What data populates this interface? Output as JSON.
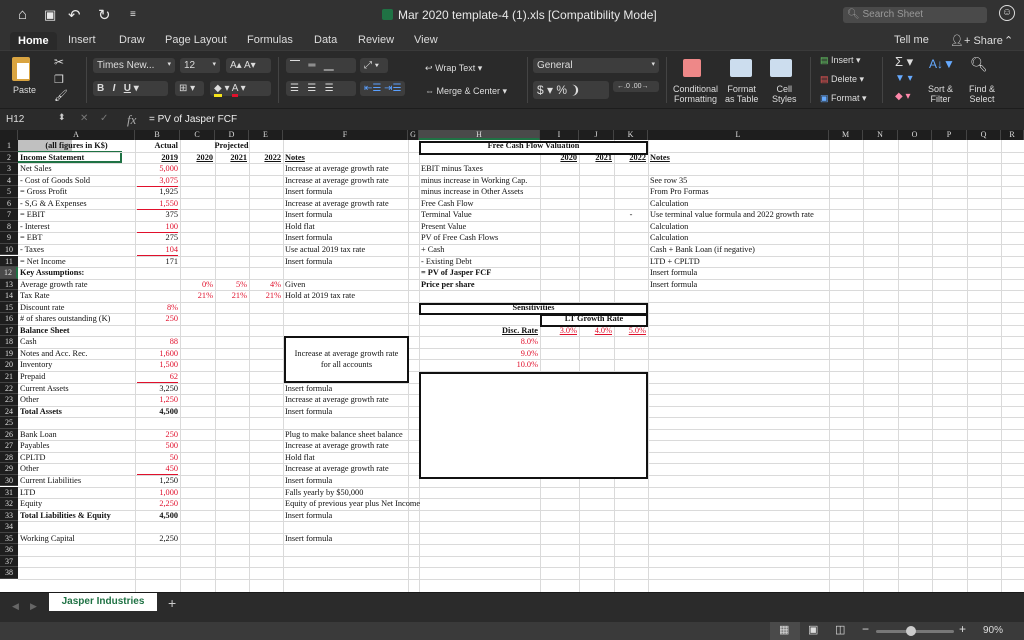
{
  "window": {
    "title": "Mar 2020 template-4 (1).xls  [Compatibility Mode]",
    "search_placeholder": "Search Sheet",
    "quick_access": [
      "home-icon",
      "save-icon",
      "undo-icon",
      "redo-icon",
      "customize-icon"
    ]
  },
  "ribbon_tabs": [
    "Home",
    "Insert",
    "Draw",
    "Page Layout",
    "Formulas",
    "Data",
    "Review",
    "View"
  ],
  "ribbon_right": {
    "tell_me": "Tell me",
    "share": "Share"
  },
  "ribbon": {
    "paste": "Paste",
    "font_name": "Times New...",
    "font_size": "12",
    "wrap_text": "Wrap Text",
    "merge_center": "Merge & Center",
    "number_format": "General",
    "conditional_formatting": [
      "Conditional",
      "Formatting"
    ],
    "format_as_table": [
      "Format",
      "as Table"
    ],
    "cell_styles": [
      "Cell",
      "Styles"
    ],
    "insert": "Insert",
    "delete": "Delete",
    "format": "Format",
    "sort_filter": [
      "Sort &",
      "Filter"
    ],
    "find_select": [
      "Find &",
      "Select"
    ],
    "colors": {
      "fill": "#f5e31a",
      "font": "#e0102c"
    }
  },
  "formula_bar": {
    "name_box": "H12",
    "fx": "fx",
    "formula": "= PV of Jasper FCF"
  },
  "columns": [
    "A",
    "B",
    "C",
    "D",
    "E",
    "F",
    "G",
    "H",
    "I",
    "J",
    "K",
    "L",
    "M",
    "N",
    "O",
    "P",
    "Q",
    "R"
  ],
  "rows": [
    "1",
    "2",
    "3",
    "4",
    "5",
    "6",
    "7",
    "8",
    "9",
    "10",
    "11",
    "12",
    "13",
    "14",
    "15",
    "16",
    "17",
    "18",
    "19",
    "20",
    "21",
    "22",
    "23",
    "24",
    "25",
    "26",
    "27",
    "28",
    "29",
    "30",
    "31",
    "32",
    "33",
    "34",
    "35",
    "36",
    "37",
    "38"
  ],
  "income": {
    "header_a": "(all figures in K$)",
    "actual": "Actual",
    "projected": "Projected",
    "years": [
      "2019",
      "2020",
      "2021",
      "2022"
    ],
    "notes_label": "Notes",
    "section": "Income Statement",
    "lines": [
      {
        "label": "Net Sales",
        "value": "5,000",
        "note": "Increase at average growth rate"
      },
      {
        "label": " - Cost of Goods Sold",
        "value": "3,075",
        "note": "Increase at average growth rate"
      },
      {
        "label": " = Gross Profit",
        "value": "1,925",
        "note": "Insert formula"
      },
      {
        "label": " - S,G & A Expenses",
        "value": "1,550",
        "note": "Increase at average growth rate"
      },
      {
        "label": " = EBIT",
        "value": "375",
        "note": "Insert formula"
      },
      {
        "label": " - Interest",
        "value": "100",
        "note": "Hold flat"
      },
      {
        "label": " = EBT",
        "value": "275",
        "note": "Insert formula"
      },
      {
        "label": " - Taxes",
        "value": "104",
        "note": "Use actual 2019 tax rate"
      },
      {
        "label": " = Net Income",
        "value": "171",
        "note": "Insert formula"
      }
    ]
  },
  "assumptions": {
    "title": "Key Assumptions:",
    "growth_label": "Average growth rate",
    "growth": [
      "0%",
      "5%",
      "4%"
    ],
    "growth_note": "Given",
    "tax_label": "Tax Rate",
    "tax": [
      "21%",
      "21%",
      "21%"
    ],
    "tax_note": "Hold at 2019 tax rate",
    "discount_label": "Discount rate",
    "discount": "8%",
    "shares_label": "# of shares outstanding (K)",
    "shares": "250"
  },
  "balance": {
    "title": "Balance Sheet",
    "assets": [
      {
        "label": "Cash",
        "value": "88"
      },
      {
        "label": "Notes and Acc. Rec.",
        "value": "1,600"
      },
      {
        "label": "Inventory",
        "value": "1,500"
      },
      {
        "label": "Prepaid",
        "value": "62"
      },
      {
        "label": "Current Assets",
        "value": "3,250",
        "note": "Insert formula"
      },
      {
        "label": "Other",
        "value": "1,250",
        "note": "Increase at average growth rate"
      },
      {
        "label": "Total Assets",
        "value": "4,500",
        "note": "Insert formula"
      }
    ],
    "asset_box_note": "Increase at average growth rate for all accounts",
    "liabilities": [
      {
        "label": "Bank Loan",
        "value": "250",
        "note": "Plug to make balance sheet balance"
      },
      {
        "label": "Payables",
        "value": "500",
        "note": "Increase at average growth rate"
      },
      {
        "label": "CPLTD",
        "value": "50",
        "note": "Hold flat"
      },
      {
        "label": "Other",
        "value": "450",
        "note": "Increase at average growth rate"
      },
      {
        "label": "Current Liabilities",
        "value": "1,250",
        "note": "Insert formula"
      },
      {
        "label": "LTD",
        "value": "1,000",
        "note": "Falls yearly by $50,000"
      },
      {
        "label": "Equity",
        "value": "2,250",
        "note": "Equity of previous year plus Net Income"
      },
      {
        "label": "Total Liabilities & Equity",
        "value": "4,500",
        "note": "Insert formula"
      }
    ],
    "wc_label": "Working Capital",
    "wc_value": "2,250",
    "wc_note": "Insert formula"
  },
  "fcf": {
    "title": "Free Cash Flow Valuation",
    "years": [
      "2020",
      "2021",
      "2022"
    ],
    "notes_label": "Notes",
    "lines": [
      {
        "label": "EBIT minus Taxes",
        "note": ""
      },
      {
        "label": "  minus increase in Working Cap.",
        "note": "See row 35"
      },
      {
        "label": "  minus increase in Other Assets",
        "note": "From Pro Formas"
      },
      {
        "label": "Free Cash Flow",
        "note": "Calculation"
      },
      {
        "label": "Terminal Value",
        "note": "Use terminal value formula and 2022 growth rate",
        "k": "-"
      },
      {
        "label": "Present Value",
        "note": "Calculation"
      },
      {
        "label": "PV of Free Cash Flows",
        "note": "Calculation"
      },
      {
        "label": " + Cash",
        "note": "Cash + Bank Loan (if negative)"
      },
      {
        "label": " - Existing Debt",
        "note": "LTD + CPLTD"
      },
      {
        "label": " = PV of Jasper FCF",
        "note": "Insert formula"
      },
      {
        "label": "Price per share",
        "note": "Insert formula"
      }
    ]
  },
  "sensitivities": {
    "title": "Sensitivities",
    "col_header": "LT Growth Rate",
    "row_header": "Disc. Rate",
    "growth_rates": [
      "3.0%",
      "4.0%",
      "5.0%"
    ],
    "disc_rates": [
      "8.0%",
      "9.0%",
      "10.0%"
    ]
  },
  "sheet_tabs": {
    "active": "Jasper Industries",
    "add": "+"
  },
  "status": {
    "zoom": "90%",
    "zoom_level": 0.45
  }
}
